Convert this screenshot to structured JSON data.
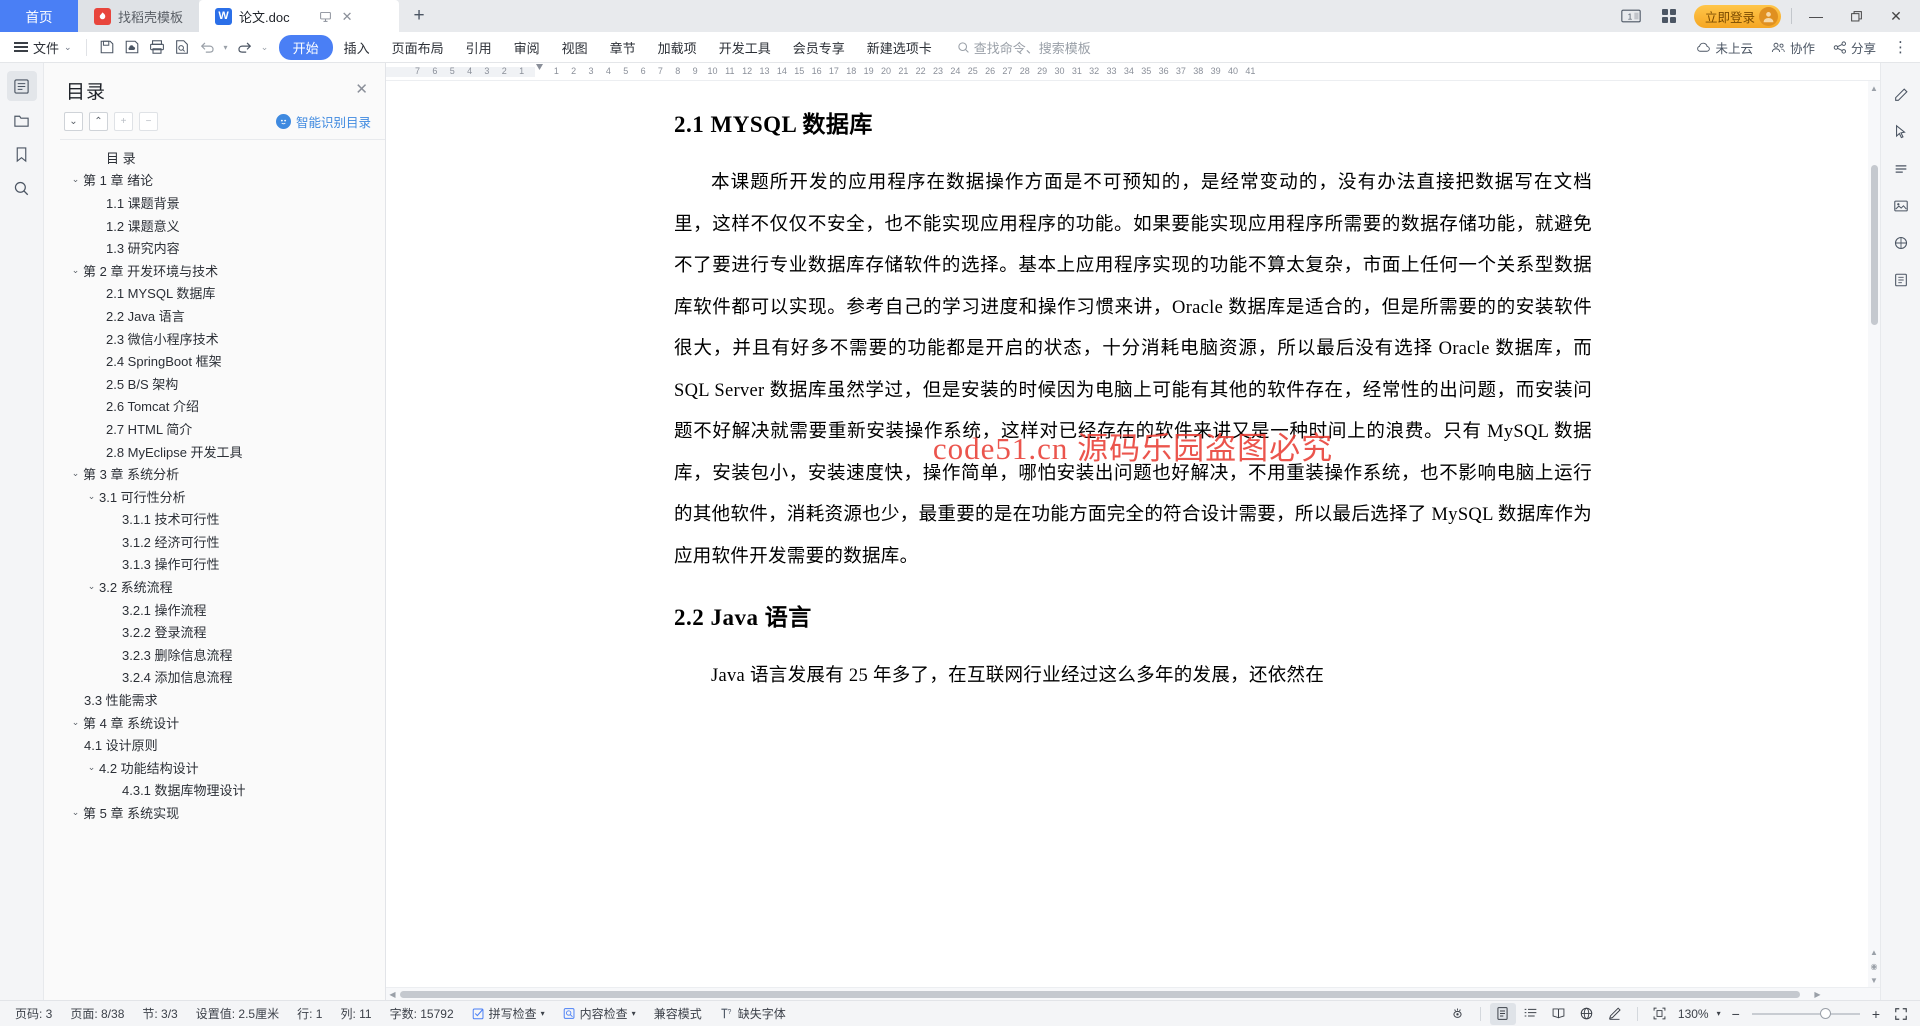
{
  "window": {
    "tabs": [
      {
        "name": "home-tab",
        "label": "首页",
        "icon": null,
        "state": "home"
      },
      {
        "name": "template-tab",
        "label": "找稻壳模板",
        "icon": "dock-icon",
        "state": "inactive"
      },
      {
        "name": "document-tab",
        "label": "论文.doc",
        "icon": "wps-writer-icon",
        "state": "active"
      }
    ],
    "tab_actions": {
      "present_label": "▭",
      "close_label": "✕"
    },
    "new_tab_label": "+",
    "right_buttons": [
      {
        "name": "single-page-view-button",
        "label": "1"
      },
      {
        "name": "grid-view-button",
        "label": "▦"
      }
    ],
    "login_label": "立即登录",
    "controls": {
      "minimize": "—",
      "restore": "❐",
      "close": "✕"
    }
  },
  "ribbon": {
    "file_label": "文件",
    "quick_access": [
      {
        "name": "save-button",
        "label": "save-icon"
      },
      {
        "name": "save-cloud-button",
        "label": "cloud-save-icon"
      },
      {
        "name": "print-button",
        "label": "print-icon"
      },
      {
        "name": "print-preview-button",
        "label": "print-preview-icon"
      },
      {
        "name": "undo-button",
        "label": "undo-icon"
      },
      {
        "name": "redo-button",
        "label": "redo-icon"
      },
      {
        "name": "customize-qat-button",
        "label": "chevron-down-icon"
      }
    ],
    "menu_items": [
      {
        "name": "tab-start",
        "label": "开始",
        "active": true
      },
      {
        "name": "tab-insert",
        "label": "插入",
        "active": false
      },
      {
        "name": "tab-page-layout",
        "label": "页面布局",
        "active": false
      },
      {
        "name": "tab-references",
        "label": "引用",
        "active": false
      },
      {
        "name": "tab-review",
        "label": "审阅",
        "active": false
      },
      {
        "name": "tab-view",
        "label": "视图",
        "active": false
      },
      {
        "name": "tab-chapter",
        "label": "章节",
        "active": false
      },
      {
        "name": "tab-addins",
        "label": "加载项",
        "active": false
      },
      {
        "name": "tab-dev-tools",
        "label": "开发工具",
        "active": false
      },
      {
        "name": "tab-member-exclusive",
        "label": "会员专享",
        "active": false
      },
      {
        "name": "tab-new-tab",
        "label": "新建选项卡",
        "active": false
      }
    ],
    "search_placeholder": "查找命令、搜索模板",
    "right_items": [
      {
        "name": "cloud-status-button",
        "label": "未上云",
        "icon": "cloud-icon"
      },
      {
        "name": "collaborate-button",
        "label": "协作",
        "icon": "people-icon"
      },
      {
        "name": "share-button",
        "label": "分享",
        "icon": "share-icon"
      }
    ],
    "more_label": "⋮"
  },
  "left_rail": [
    {
      "name": "rail-outline-button",
      "icon": "outline-icon",
      "selected": true
    },
    {
      "name": "rail-files-button",
      "icon": "folder-icon",
      "selected": false
    },
    {
      "name": "rail-bookmark-button",
      "icon": "bookmark-icon",
      "selected": false
    },
    {
      "name": "rail-search-button",
      "icon": "search-icon",
      "selected": false
    }
  ],
  "outline": {
    "title": "目录",
    "close_label": "✕",
    "tools": [
      {
        "name": "expand-all-button",
        "label": "⌄"
      },
      {
        "name": "collapse-all-button",
        "label": "⌃"
      },
      {
        "name": "increase-level-button",
        "label": "+"
      },
      {
        "name": "decrease-level-button",
        "label": "−"
      }
    ],
    "smart_toc_label": "智能识别目录",
    "items": [
      {
        "label": "目  录",
        "level": 0,
        "caret": ""
      },
      {
        "label": "第 1 章 绪论",
        "level": 1,
        "caret": "⌄"
      },
      {
        "label": "1.1 课题背景",
        "level": 2,
        "caret": ""
      },
      {
        "label": "1.2 课题意义",
        "level": 2,
        "caret": ""
      },
      {
        "label": "1.3 研究内容",
        "level": 2,
        "caret": ""
      },
      {
        "label": "第 2 章 开发环境与技术",
        "level": 1,
        "caret": "⌄"
      },
      {
        "label": "2.1 MYSQL 数据库",
        "level": 2,
        "caret": ""
      },
      {
        "label": "2.2 Java 语言",
        "level": 2,
        "caret": ""
      },
      {
        "label": "2.3  微信小程序技术",
        "level": 2,
        "caret": ""
      },
      {
        "label": "2.4 SpringBoot 框架",
        "level": 2,
        "caret": ""
      },
      {
        "label": "2.5 B/S 架构",
        "level": 2,
        "caret": ""
      },
      {
        "label": "2.6 Tomcat  介绍",
        "level": 2,
        "caret": ""
      },
      {
        "label": "2.7 HTML 简介",
        "level": 2,
        "caret": ""
      },
      {
        "label": "2.8 MyEclipse 开发工具",
        "level": 2,
        "caret": ""
      },
      {
        "label": "第 3 章 系统分析",
        "level": 1,
        "caret": "⌄"
      },
      {
        "label": "3.1  可行性分析",
        "level": 2.5,
        "caret": "⌄"
      },
      {
        "label": "3.1.1  技术可行性",
        "level": 3,
        "caret": ""
      },
      {
        "label": "3.1.2  经济可行性",
        "level": 3,
        "caret": ""
      },
      {
        "label": "3.1.3  操作可行性",
        "level": 3,
        "caret": ""
      },
      {
        "label": "3.2  系统流程",
        "level": 2.5,
        "caret": "⌄"
      },
      {
        "label": "3.2.1  操作流程",
        "level": 3,
        "caret": ""
      },
      {
        "label": "3.2.2  登录流程",
        "level": 3,
        "caret": ""
      },
      {
        "label": "3.2.3  删除信息流程",
        "level": 3,
        "caret": ""
      },
      {
        "label": "3.2.4  添加信息流程",
        "level": 3,
        "caret": ""
      },
      {
        "label": "3.3  性能需求",
        "level": 2.5,
        "caret": ""
      },
      {
        "label": "第 4 章 系统设计",
        "level": 1,
        "caret": "⌄"
      },
      {
        "label": "4.1  设计原则",
        "level": 2.5,
        "caret": ""
      },
      {
        "label": "4.2  功能结构设计",
        "level": 2.5,
        "caret": "⌄"
      },
      {
        "label": "4.3.1  数据库物理设计",
        "level": 3,
        "caret": ""
      },
      {
        "label": "第 5 章 系统实现",
        "level": 1,
        "caret": "⌄"
      }
    ]
  },
  "ruler": {
    "left_ticks": [
      "7",
      "6",
      "5",
      "4",
      "3",
      "2",
      "1"
    ],
    "right_ticks": [
      "1",
      "2",
      "3",
      "4",
      "5",
      "6",
      "7",
      "8",
      "9",
      "10",
      "11",
      "12",
      "13",
      "14",
      "15",
      "16",
      "17",
      "18",
      "19",
      "20",
      "21",
      "22",
      "23",
      "24",
      "25",
      "26",
      "27",
      "28",
      "29",
      "30",
      "31",
      "32",
      "33",
      "34",
      "35",
      "36",
      "37",
      "38",
      "39",
      "40",
      "41"
    ]
  },
  "document": {
    "heading1": "2.1 MYSQL 数据库",
    "paragraph1": "本课题所开发的应用程序在数据操作方面是不可预知的，是经常变动的，没有办法直接把数据写在文档里，这样不仅仅不安全，也不能实现应用程序的功能。如果要能实现应用程序所需要的数据存储功能，就避免不了要进行专业数据库存储软件的选择。基本上应用程序实现的功能不算太复杂，市面上任何一个关系型数据库软件都可以实现。参考自己的学习进度和操作习惯来讲，Oracle 数据库是适合的，但是所需要的的安装软件很大，并且有好多不需要的功能都是开启的状态，十分消耗电脑资源，所以最后没有选择 Oracle 数据库，而 SQL Server 数据库虽然学过，但是安装的时候因为电脑上可能有其他的软件存在，经常性的出问题，而安装问题不好解决就需要重新安装操作系统，这样对已经存在的软件来讲又是一种时间上的浪费。只有 MySQL 数据库，安装包小，安装速度快，操作简单，哪怕安装出问题也好解决，不用重装操作系统，也不影响电脑上运行的其他软件，消耗资源也少，最重要的是在功能方面完全的符合设计需要，所以最后选择了 MySQL 数据库作为应用软件开发需要的数据库。",
    "heading2": "2.2 Java 语言",
    "paragraph2": "Java 语言发展有 25 年多了，在互联网行业经过这么多年的发展，还依然在",
    "watermark": "code51.cn 源码乐园盗图必究"
  },
  "right_rail": [
    {
      "name": "edit-pen-icon",
      "icon": "pen-icon"
    },
    {
      "name": "select-cursor-icon",
      "icon": "cursor-icon"
    },
    {
      "name": "paragraph-settings-icon",
      "icon": "paragraph-icon"
    },
    {
      "name": "picture-tools-icon",
      "icon": "image-icon"
    },
    {
      "name": "ocr-icon",
      "icon": "ocr-icon"
    },
    {
      "name": "pdf-tools-icon",
      "icon": "pdf-icon"
    }
  ],
  "statusbar": {
    "left_items": [
      {
        "name": "status-page-number",
        "label": "页码: 3"
      },
      {
        "name": "status-page-count",
        "label": "页面: 8/38"
      },
      {
        "name": "status-section",
        "label": "节: 3/3"
      },
      {
        "name": "status-setting-value",
        "label": "设置值: 2.5厘米"
      },
      {
        "name": "status-row",
        "label": "行: 1"
      },
      {
        "name": "status-column",
        "label": "列: 11"
      },
      {
        "name": "status-word-count",
        "label": "字数: 15792"
      },
      {
        "name": "status-spell-check",
        "label": "拼写检查",
        "icon": "check-box-icon",
        "dropdown": "▾"
      },
      {
        "name": "status-content-check",
        "label": "内容检查",
        "icon": "magnifier-box-icon",
        "dropdown": "▾"
      },
      {
        "name": "status-compatibility-mode",
        "label": "兼容模式"
      },
      {
        "name": "status-missing-font",
        "label": "缺失字体",
        "icon": "font-warning-icon"
      }
    ],
    "view_buttons": [
      {
        "name": "view-focus-button",
        "icon": "eye-icon",
        "selected": false
      },
      {
        "name": "view-page-layout-button",
        "icon": "page-icon",
        "selected": true
      },
      {
        "name": "view-outline-button",
        "icon": "outline-list-icon",
        "selected": false
      },
      {
        "name": "view-reading-button",
        "icon": "book-icon",
        "selected": false
      },
      {
        "name": "view-web-button",
        "icon": "globe-icon",
        "selected": false
      },
      {
        "name": "view-writing-button",
        "icon": "pen-write-icon",
        "selected": false
      }
    ],
    "fit_page_icon": "fit-page-icon",
    "zoom_label": "130%",
    "zoom_dropdown": "▾",
    "zoom_out_label": "−",
    "zoom_in_label": "+",
    "fullscreen_icon": "fullscreen-icon"
  },
  "colors": {
    "accent": "#4a7ff5",
    "tab_bar_bg": "#e8eaed",
    "login_gold": "#f5a623",
    "watermark_red": "#e8382f",
    "panel_bg": "#fafafa"
  }
}
